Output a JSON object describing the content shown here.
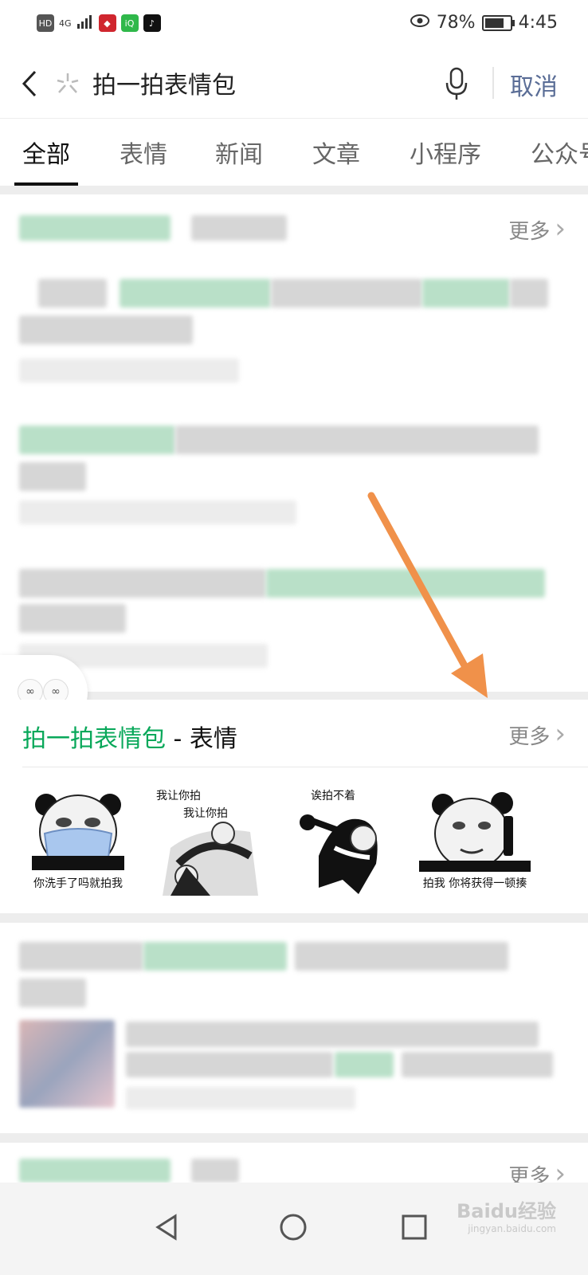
{
  "status_bar": {
    "network": "4G",
    "battery_percent": "78%",
    "time": "4:45"
  },
  "search": {
    "query": "拍一拍表情包",
    "cancel_label": "取消"
  },
  "tabs": [
    {
      "label": "全部",
      "active": true
    },
    {
      "label": "表情",
      "active": false
    },
    {
      "label": "新闻",
      "active": false
    },
    {
      "label": "文章",
      "active": false
    },
    {
      "label": "小程序",
      "active": false
    },
    {
      "label": "公众号",
      "active": false
    }
  ],
  "section_more_label": "更多",
  "emoji_section": {
    "query_highlight": "拍一拍表情包",
    "separator": " - ",
    "category": "表情",
    "more_label": "更多",
    "items": [
      {
        "caption": "你洗手了吗就拍我"
      },
      {
        "caption_top": "我让你拍",
        "caption_mid": "我让你拍"
      },
      {
        "caption_top": "诶拍不着"
      },
      {
        "caption": "拍我 你将获得一顿揍"
      }
    ]
  },
  "watermark": {
    "brand": "Baidu经验",
    "sub": "jingyan.baidu.com"
  },
  "colors": {
    "highlight_green": "#09a85a",
    "cancel_blue": "#5a6d96",
    "arrow_orange": "#f0914a"
  }
}
